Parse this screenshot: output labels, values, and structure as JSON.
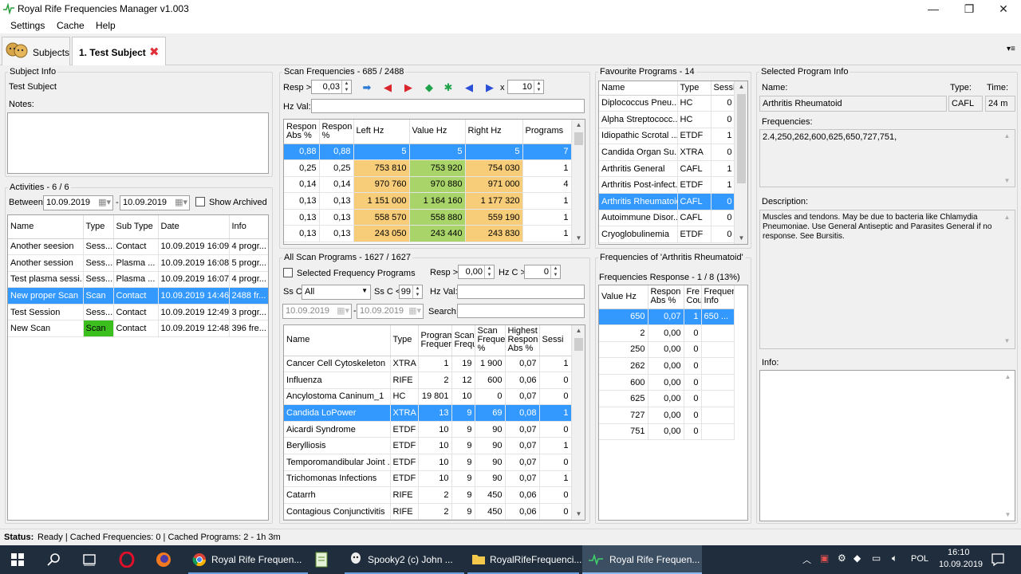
{
  "window": {
    "title": "Royal Rife Frequencies Manager v1.003",
    "minimize": "—",
    "maximize": "❐",
    "close": "✕"
  },
  "menu": [
    "Settings",
    "Cache",
    "Help"
  ],
  "tabs": {
    "subjects": "Subjects",
    "subject_tab": "1. Test Subject",
    "close_glyph": "✖",
    "overflow": "▾≡"
  },
  "subject_info": {
    "legend": "Subject Info",
    "name": "Test Subject",
    "notes_label": "Notes:"
  },
  "activities": {
    "legend": "Activities - 6 / 6",
    "between_label": "Between",
    "date_from": "10.09.2019",
    "date_to": "10.09.2019",
    "dash": "-",
    "show_archived": "Show Archived",
    "columns": [
      "Name",
      "Type",
      "Sub Type",
      "Date",
      "Info"
    ],
    "rows": [
      [
        "Another seesion",
        "Sess...",
        "Contact",
        "10.09.2019 16:09",
        "4 progr..."
      ],
      [
        "Another session",
        "Sess...",
        "Plasma ...",
        "10.09.2019 16:08",
        "5 progr..."
      ],
      [
        "Test plasma sessi...",
        "Sess...",
        "Plasma ...",
        "10.09.2019 16:07",
        "4 progr..."
      ],
      [
        "New proper Scan",
        "Scan",
        "Contact",
        "10.09.2019 14:46",
        "2488 fr..."
      ],
      [
        "Test Session",
        "Sess...",
        "Contact",
        "10.09.2019 12:49",
        "3 progr..."
      ],
      [
        "New Scan",
        "Scan",
        "Contact",
        "10.09.2019 12:48",
        "396 fre..."
      ]
    ],
    "selected_row": 3,
    "green_cell_row": 5,
    "green_color": "#3cbf1e"
  },
  "scan_freq": {
    "legend": "Scan Frequencies - 685 / 2488",
    "resp_label": "Resp >",
    "resp_value": "0,03",
    "x_label": "x",
    "x_value": "10",
    "hz_label": "Hz Val:",
    "nav_icons": [
      "➡",
      "◀",
      "▶",
      "◆",
      "✱",
      "◀",
      "▶"
    ],
    "columns": [
      "Respon Abs %",
      "Respon %",
      "Left Hz",
      "Value Hz",
      "Right Hz",
      "Programs"
    ],
    "rows": [
      [
        "0,88",
        "0,88",
        "5",
        "5",
        "5",
        "7"
      ],
      [
        "0,25",
        "0,25",
        "753 810",
        "753 920",
        "754 030",
        "1"
      ],
      [
        "0,14",
        "0,14",
        "970 760",
        "970 880",
        "971 000",
        "4"
      ],
      [
        "0,13",
        "0,13",
        "1 151 000",
        "1 164 160",
        "1 177 320",
        "1"
      ],
      [
        "0,13",
        "0,13",
        "558 570",
        "558 880",
        "559 190",
        "1"
      ],
      [
        "0,13",
        "0,13",
        "243 050",
        "243 440",
        "243 830",
        "1"
      ]
    ],
    "left_color": "#f8cd79",
    "value_color": "#a8d46a",
    "right_color": "#f8cd79"
  },
  "all_scan": {
    "legend": "All Scan Programs - 1627 / 1627",
    "selected_freq_label": "Selected Frequency Programs",
    "resp_label": "Resp >",
    "resp_value": "0,00",
    "hzc_label": "Hz C >",
    "hzc_value": "0",
    "ssc_label": "Ss C:",
    "ssc_value": "All",
    "ssc2_label": "Ss C <",
    "ssc2_value": "99",
    "hzval_label": "Hz Val:",
    "date_from": "10.09.2019",
    "date_to": "10.09.2019",
    "search_label": "Search:",
    "columns": [
      "Name",
      "Type",
      "Program Frequen",
      "Scan Frequ",
      "Scan Freque %",
      "Highest Respon Abs %",
      "Sessi"
    ],
    "rows": [
      [
        "Cancer Cell Cytoskeleton",
        "XTRA",
        "1",
        "19",
        "1 900",
        "0,07",
        "1"
      ],
      [
        "Influenza",
        "RIFE",
        "2",
        "12",
        "600",
        "0,06",
        "0"
      ],
      [
        "Ancylostoma Caninum_1",
        "HC",
        "19 801",
        "10",
        "0",
        "0,07",
        "0"
      ],
      [
        "Candida LoPower",
        "XTRA",
        "13",
        "9",
        "69",
        "0,08",
        "1"
      ],
      [
        "Aicardi Syndrome",
        "ETDF",
        "10",
        "9",
        "90",
        "0,07",
        "0"
      ],
      [
        "Berylliosis",
        "ETDF",
        "10",
        "9",
        "90",
        "0,07",
        "1"
      ],
      [
        "Temporomandibular Joint ...",
        "ETDF",
        "10",
        "9",
        "90",
        "0,07",
        "0"
      ],
      [
        "Trichomonas Infections",
        "ETDF",
        "10",
        "9",
        "90",
        "0,07",
        "1"
      ],
      [
        "Catarrh",
        "RIFE",
        "2",
        "9",
        "450",
        "0,06",
        "0"
      ],
      [
        "Contagious Conjunctivitis",
        "RIFE",
        "2",
        "9",
        "450",
        "0,06",
        "0"
      ]
    ],
    "selected_row": 3
  },
  "favourites": {
    "legend": "Favourite Programs - 14",
    "columns": [
      "Name",
      "Type",
      "Sessi"
    ],
    "rows": [
      [
        "Diplococcus Pneu...",
        "HC",
        "0"
      ],
      [
        "Alpha Streptococc...",
        "HC",
        "0"
      ],
      [
        "Idiopathic Scrotal ...",
        "ETDF",
        "1"
      ],
      [
        "Candida Organ Su...",
        "XTRA",
        "0"
      ],
      [
        "Arthritis General",
        "CAFL",
        "1"
      ],
      [
        "Arthritis Post-infect...",
        "ETDF",
        "1"
      ],
      [
        "Arthritis Rheumatoid",
        "CAFL",
        "0"
      ],
      [
        "Autoimmune Disor...",
        "CAFL",
        "0"
      ],
      [
        "Cryoglobulinemia",
        "ETDF",
        "0"
      ]
    ],
    "selected_row": 6
  },
  "freq_of": {
    "legend": "Frequencies of 'Arthritis Rheumatoid'",
    "response_label": "Frequencies Response - 1 / 8 (13%)",
    "columns": [
      "Value Hz",
      "Respon Abs %",
      "Fre Cou",
      "Frequen Info"
    ],
    "rows": [
      [
        "650",
        "0,07",
        "1",
        "650 ..."
      ],
      [
        "2",
        "0,00",
        "0",
        ""
      ],
      [
        "250",
        "0,00",
        "0",
        ""
      ],
      [
        "262",
        "0,00",
        "0",
        ""
      ],
      [
        "600",
        "0,00",
        "0",
        ""
      ],
      [
        "625",
        "0,00",
        "0",
        ""
      ],
      [
        "727",
        "0,00",
        "0",
        ""
      ],
      [
        "751",
        "0,00",
        "0",
        ""
      ]
    ],
    "selected_row": 0
  },
  "selected_program": {
    "legend": "Selected Program Info",
    "name_label": "Name:",
    "name_value": "Arthritis Rheumatoid",
    "type_label": "Type:",
    "type_value": "CAFL",
    "time_label": "Time:",
    "time_value": "24 m",
    "freq_label": "Frequencies:",
    "freq_value": "2.4,250,262,600,625,650,727,751,",
    "desc_label": "Description:",
    "desc_value": "Muscles and tendons. May be due to bacteria like Chlamydia Pneumoniae. Use General Antiseptic and Parasites General if no response. See Bursitis.",
    "info_label": "Info:"
  },
  "status": {
    "label": "Status:",
    "text": "Ready | Cached Frequencies: 0 | Cached Programs: 2 - 1h 3m"
  },
  "taskbar": {
    "apps": [
      "Royal Rife Frequen...",
      "Spooky2 (c) John ...",
      "RoyalRifeFrequenci...",
      "Royal Rife Frequen..."
    ],
    "lang": "POL",
    "time": "16:10",
    "date": "10.09.2019"
  },
  "colors": {
    "selection": "#3399ff",
    "taskbar": "#1f2d3d",
    "tab_close": "#e0303a"
  }
}
